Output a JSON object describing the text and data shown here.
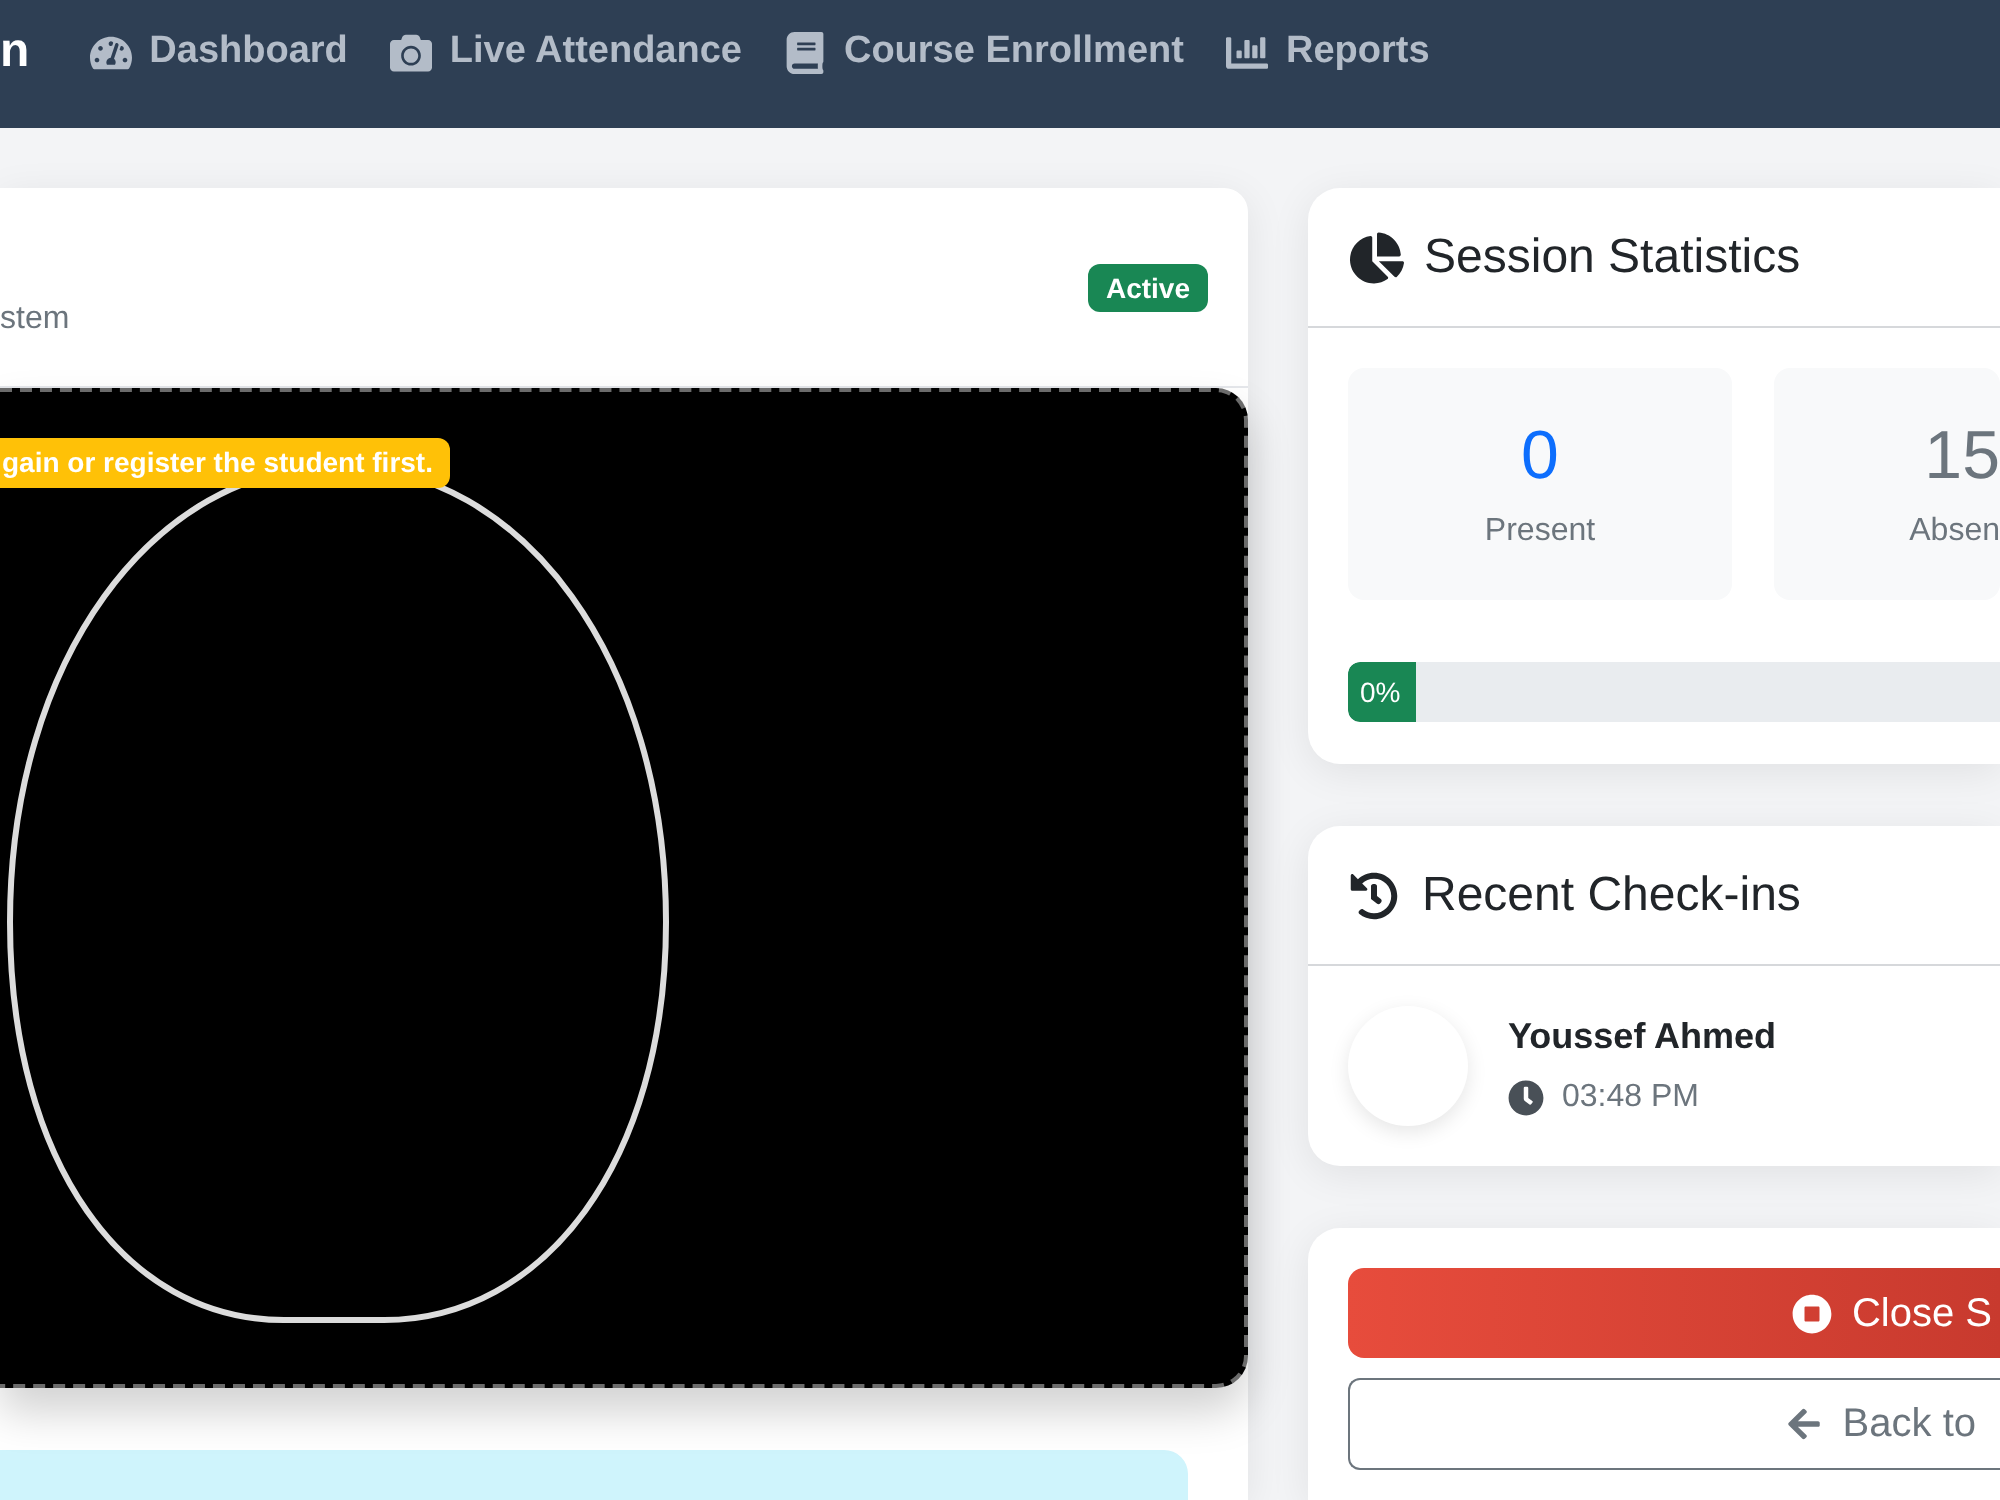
{
  "navbar": {
    "brand": "n",
    "links": [
      "Dashboard",
      "Live Attendance",
      "Course Enrollment",
      "Reports"
    ]
  },
  "camera_panel": {
    "subtitle": "stem",
    "status": "Active",
    "notice": "gain or register the student first."
  },
  "session_statistics": {
    "title": "Session Statistics",
    "stats": [
      {
        "kind": "present",
        "value": "0",
        "label": "Present"
      },
      {
        "kind": "absent",
        "value": "15",
        "label": "Absen"
      }
    ],
    "progress": {
      "level": 0,
      "label": "0%"
    }
  },
  "recent_checkins": {
    "title": "Recent Check-ins",
    "items": [
      {
        "name": "Youssef Ahmed",
        "time": "03:48 PM"
      }
    ]
  },
  "actions": [
    {
      "kind": "danger",
      "label": "Close S"
    },
    {
      "kind": "outline",
      "label": "Back to"
    }
  ]
}
